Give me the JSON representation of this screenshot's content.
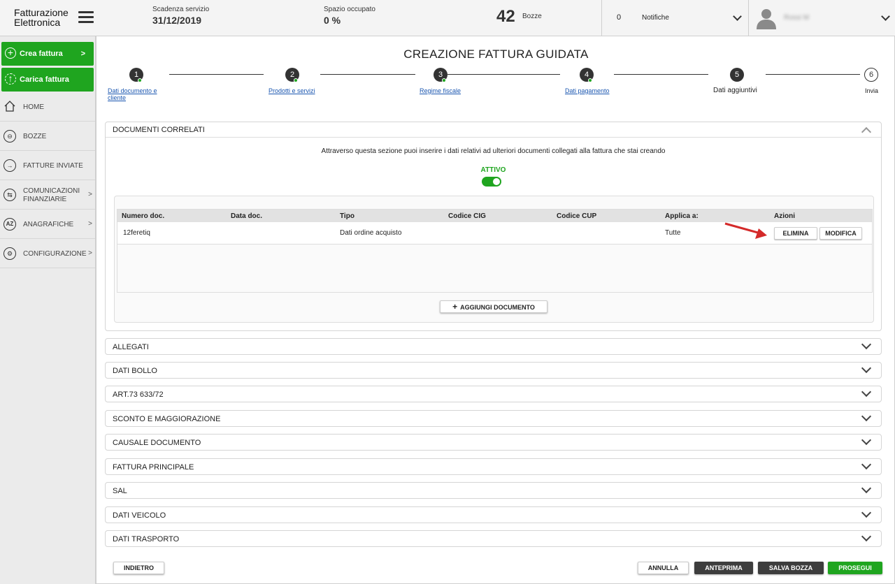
{
  "header": {
    "logo_line1": "Fatturazione",
    "logo_line2": "Elettronica",
    "scadenza_label": "Scadenza servizio",
    "scadenza_value": "31/12/2019",
    "spazio_label": "Spazio occupato",
    "spazio_value": "0 %",
    "bozze_count": "42",
    "bozze_label": "Bozze",
    "notifiche_count": "0",
    "notifiche_label": "Notifiche",
    "user_name": "Rossi M"
  },
  "sidebar": {
    "crea_fattura": "Crea fattura",
    "carica_fattura": "Carica fattura",
    "items": [
      {
        "label": "HOME"
      },
      {
        "label": "BOZZE"
      },
      {
        "label": "FATTURE INVIATE"
      },
      {
        "label": "COMUNICAZIONI FINANZIARIE"
      },
      {
        "label": "ANAGRAFICHE"
      },
      {
        "label": "CONFIGURAZIONE"
      }
    ]
  },
  "main": {
    "title": "CREAZIONE FATTURA GUIDATA",
    "steps": [
      {
        "num": "1",
        "label_line1": "Dati documento e",
        "label_line2": "cliente"
      },
      {
        "num": "2",
        "label": "Prodotti e servizi"
      },
      {
        "num": "3",
        "label": "Regime fiscale"
      },
      {
        "num": "4",
        "label": "Dati pagamento"
      },
      {
        "num": "5",
        "label": "Dati aggiuntivi"
      },
      {
        "num": "6",
        "label": "Invia"
      }
    ],
    "documenti": {
      "title": "DOCUMENTI CORRELATI",
      "info": "Attraverso questa sezione puoi inserire i dati relativi ad ulteriori documenti collegati alla fattura che stai creando",
      "status": "ATTIVO",
      "columns": [
        "Numero doc.",
        "Data doc.",
        "Tipo",
        "Codice CIG",
        "Codice CUP",
        "Applica a:",
        "Azioni"
      ],
      "rows": [
        {
          "numero": "12feretiq",
          "data": "",
          "tipo": "Dati ordine acquisto",
          "cig": "",
          "cup": "",
          "applica": "Tutte"
        }
      ],
      "elimina": "ELIMINA",
      "modifica": "MODIFICA",
      "aggiungi": "AGGIUNGI DOCUMENTO"
    },
    "sections": [
      "ALLEGATI",
      "DATI BOLLO",
      "ART.73 633/72",
      "SCONTO E MAGGIORAZIONE",
      "CAUSALE DOCUMENTO",
      "FATTURA PRINCIPALE",
      "SAL",
      "DATI VEICOLO",
      "DATI TRASPORTO"
    ],
    "footer": {
      "indietro": "INDIETRO",
      "annulla": "ANNULLA",
      "anteprima": "ANTEPRIMA",
      "salva": "SALVA BOZZA",
      "prosegui": "PROSEGUI"
    }
  },
  "colors": {
    "green": "#1fa51f",
    "dark": "#3d3d3d",
    "link": "#1a56b0",
    "arrow": "#d42a2a"
  }
}
